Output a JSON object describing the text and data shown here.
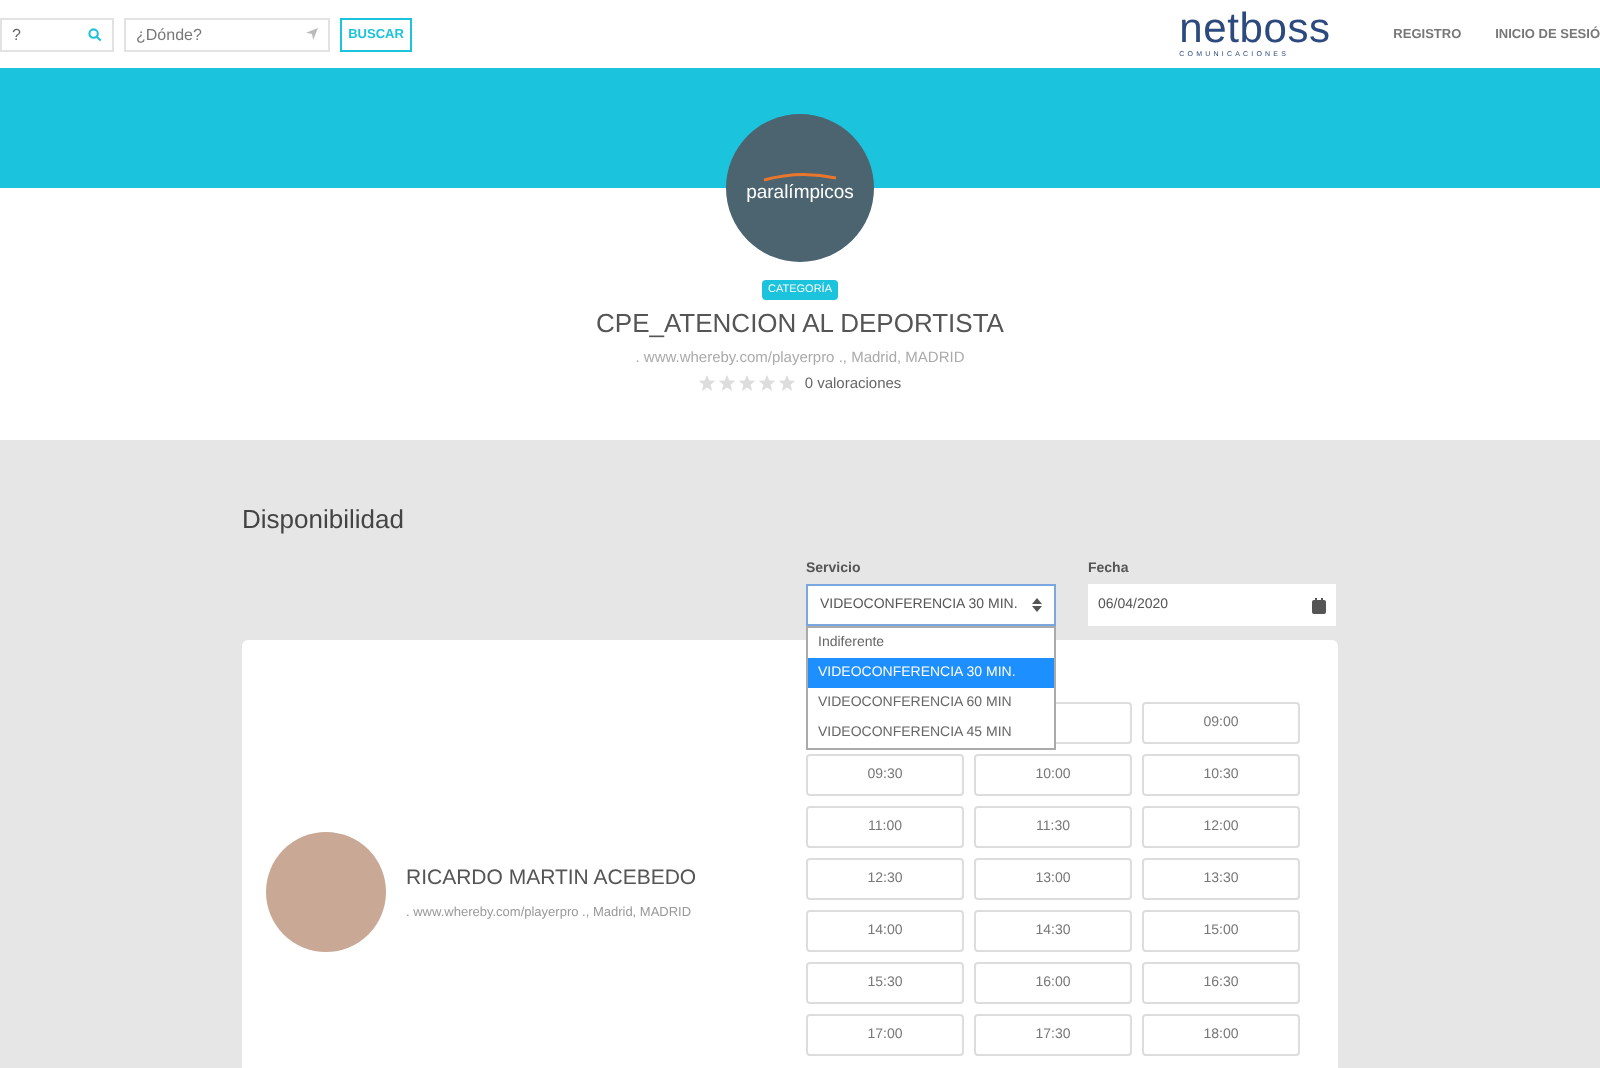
{
  "header": {
    "search": {
      "value": "?"
    },
    "where": {
      "placeholder": "¿Dónde?"
    },
    "search_button": "BUSCAR",
    "logo": {
      "name": "netboss",
      "tagline": "COMUNICACIONES"
    },
    "nav": [
      "REGISTRO",
      "INICIO DE SESIÓ"
    ]
  },
  "profile": {
    "logo_text": "paralímpicos",
    "badge": "CATEGORÍA",
    "title": "CPE_ATENCION AL DEPORTISTA",
    "address": ". www.whereby.com/playerpro ., Madrid, MADRID",
    "stars": 0,
    "ratings": "0 valoraciones"
  },
  "availability": {
    "title": "Disponibilidad",
    "service": {
      "label": "Servicio",
      "value": "VIDEOCONFERENCIA 30 MIN.",
      "expanded": true,
      "options": [
        {
          "label": "Indiferente",
          "selected": false
        },
        {
          "label": "VIDEOCONFERENCIA 30 MIN.",
          "selected": true
        },
        {
          "label": "VIDEOCONFERENCIA 60 MIN",
          "selected": false
        },
        {
          "label": "VIDEOCONFERENCIA 45 MIN",
          "selected": false
        }
      ]
    },
    "date": {
      "label": "Fecha",
      "value": "06/04/2020"
    },
    "professional": {
      "name": "RICARDO MARTIN ACEBEDO",
      "address": ". www.whereby.com/playerpro ., Madrid, MADRID"
    },
    "slots": [
      {
        "label": "09:00"
      },
      {
        "label": "09:30"
      },
      {
        "label": "10:00"
      },
      {
        "label": "10:30"
      },
      {
        "label": "11:00"
      },
      {
        "label": "11:30"
      },
      {
        "label": "12:00"
      },
      {
        "label": "12:30"
      },
      {
        "label": "13:00"
      },
      {
        "label": "13:30"
      },
      {
        "label": "14:00"
      },
      {
        "label": "14:30"
      },
      {
        "label": "15:00"
      },
      {
        "label": "15:30"
      },
      {
        "label": "16:00"
      },
      {
        "label": "16:30"
      },
      {
        "label": "17:00"
      },
      {
        "label": "17:30"
      },
      {
        "label": "18:00"
      }
    ]
  }
}
